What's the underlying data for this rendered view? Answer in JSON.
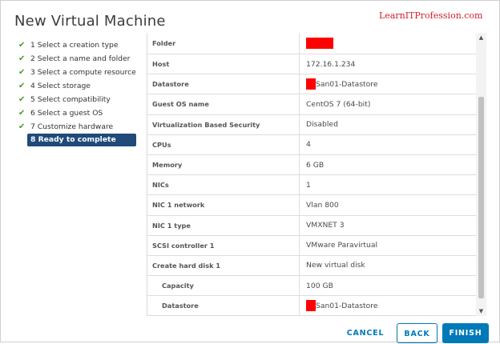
{
  "dialog": {
    "title": "New Virtual Machine",
    "watermark": "LearnITProfession.com"
  },
  "steps": [
    {
      "label": "1 Select a creation type",
      "done": true
    },
    {
      "label": "2 Select a name and folder",
      "done": true
    },
    {
      "label": "3 Select a compute resource",
      "done": true
    },
    {
      "label": "4 Select storage",
      "done": true
    },
    {
      "label": "5 Select compatibility",
      "done": true
    },
    {
      "label": "6 Select a guest OS",
      "done": true
    },
    {
      "label": "7 Customize hardware",
      "done": true
    },
    {
      "label": "8 Ready to complete",
      "done": false,
      "active": true
    }
  ],
  "check_icon": "✔",
  "summary": {
    "rows": [
      {
        "label": "Folder",
        "value": "",
        "redacted": true
      },
      {
        "label": "Host",
        "value": "172.16.1.234"
      },
      {
        "label": "Datastore",
        "value": "San01-Datastore",
        "redacted": true
      },
      {
        "label": "Guest OS name",
        "value": "CentOS 7 (64-bit)"
      },
      {
        "label": "Virtualization Based Security",
        "value": "Disabled"
      },
      {
        "label": "CPUs",
        "value": "4"
      },
      {
        "label": "Memory",
        "value": "6 GB"
      },
      {
        "label": "NICs",
        "value": "1"
      },
      {
        "label": "NIC 1 network",
        "value": "Vlan 800"
      },
      {
        "label": "NIC 1 type",
        "value": "VMXNET 3"
      },
      {
        "label": "SCSI controller 1",
        "value": "VMware Paravirtual"
      },
      {
        "label": "Create hard disk 1",
        "value": "New virtual disk"
      },
      {
        "label": "Capacity",
        "value": "100 GB",
        "indent": true
      },
      {
        "label": "Datastore",
        "value": "San01-Datastore",
        "indent": true,
        "redacted": true
      }
    ]
  },
  "buttons": {
    "cancel": "CANCEL",
    "back": "BACK",
    "finish": "FINISH"
  },
  "colors": {
    "accent": "#0079b8",
    "active_step_bg": "#1f4a79",
    "check": "#4a9a27",
    "redaction": "#ff0000"
  },
  "scrollbar": {
    "up_icon": "▲",
    "down_icon": "▼"
  }
}
